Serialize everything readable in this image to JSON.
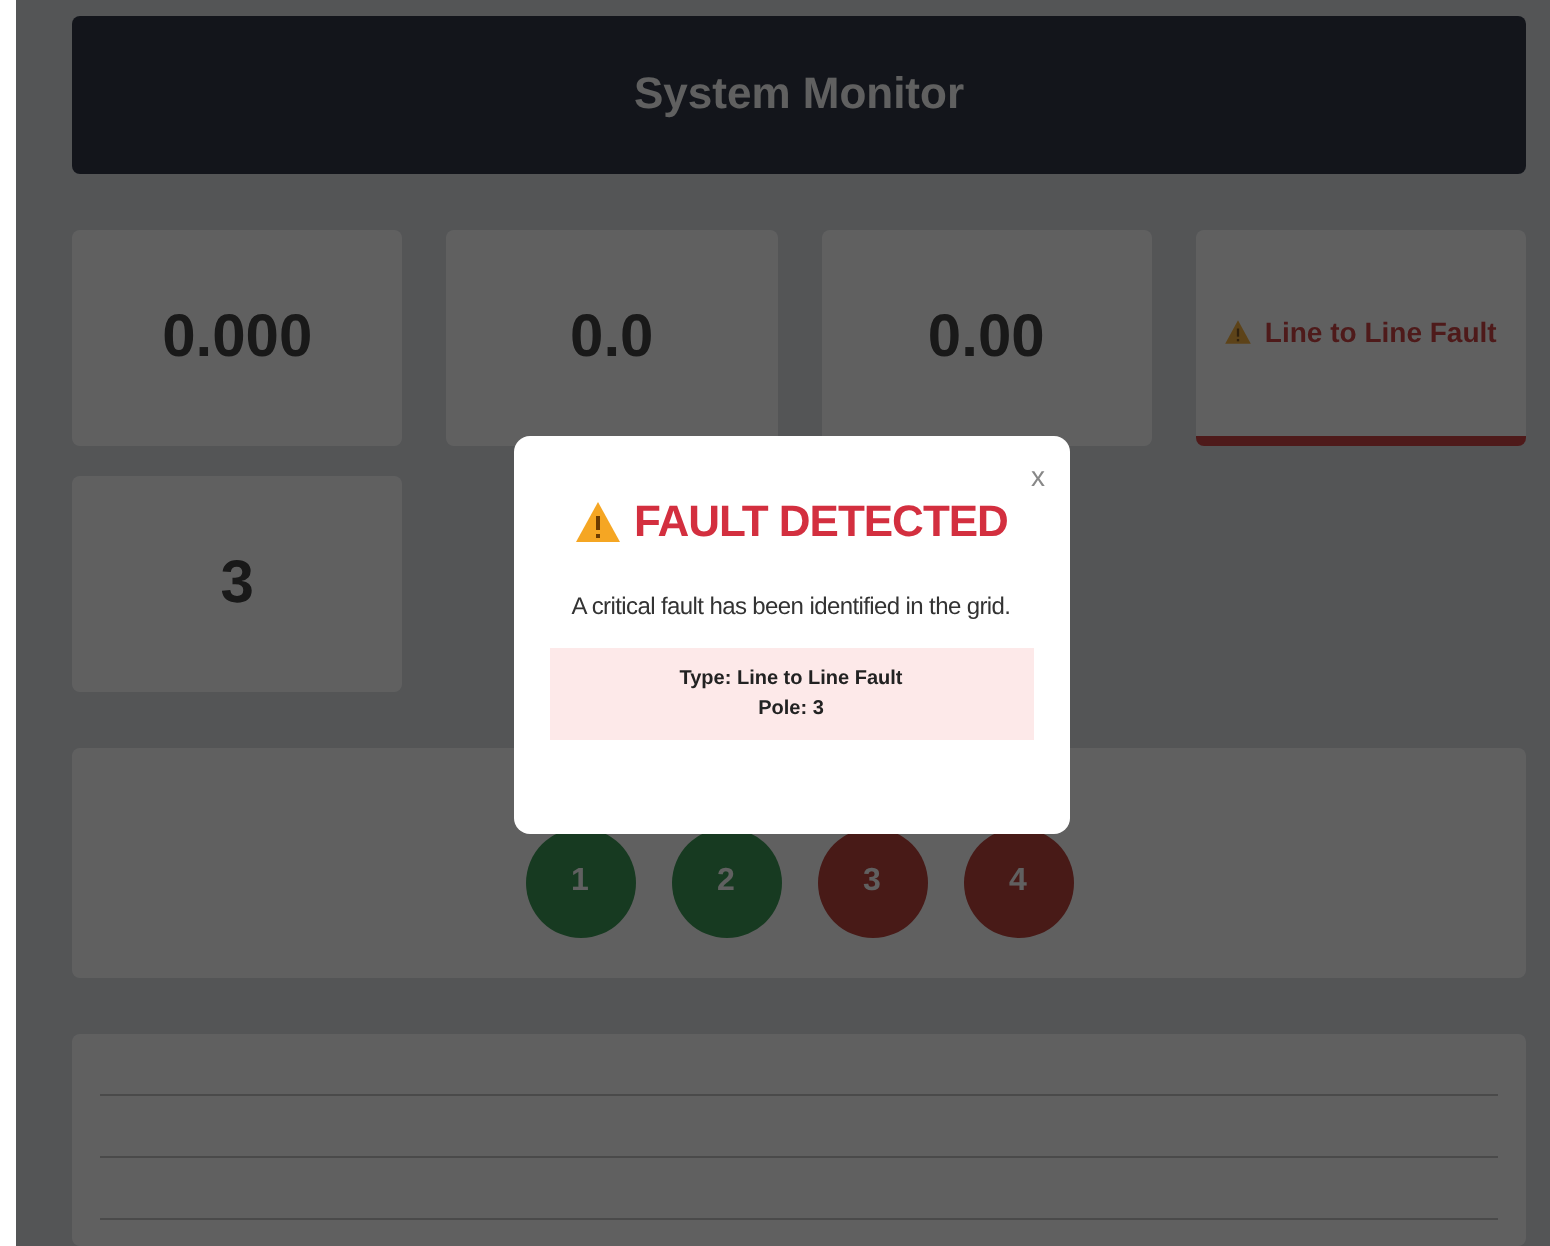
{
  "header": {
    "title": "System Monitor"
  },
  "metrics": [
    {
      "value": "0.000",
      "kind": "number"
    },
    {
      "value": "0.0",
      "kind": "number"
    },
    {
      "value": "0.00",
      "kind": "number"
    },
    {
      "value": "Line to Line Fault",
      "kind": "status"
    },
    {
      "value": "3",
      "kind": "number"
    }
  ],
  "poles": [
    {
      "label": "1",
      "kind": "healthy"
    },
    {
      "label": "2",
      "kind": "healthy"
    },
    {
      "label": "3",
      "kind": "faulted"
    },
    {
      "label": "4",
      "kind": "faulted"
    }
  ],
  "modal": {
    "close": "x",
    "title": "FAULT DETECTED",
    "message": "A critical fault has been identified in the grid.",
    "details": [
      "Type: Line to Line Fault",
      "Pole: 3"
    ]
  }
}
